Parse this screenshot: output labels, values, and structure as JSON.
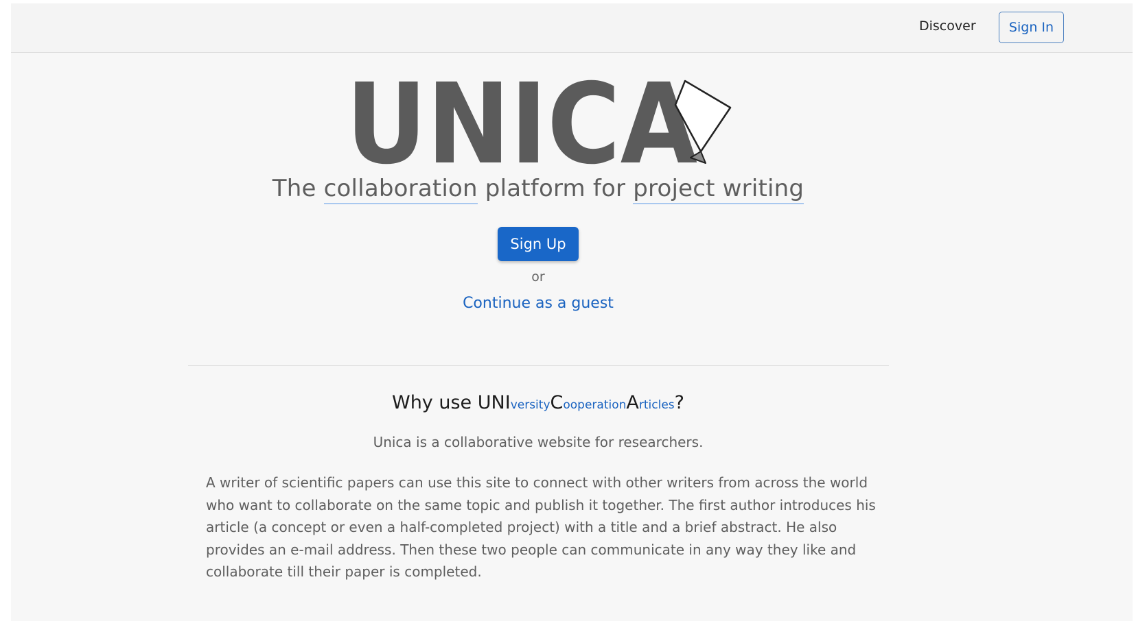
{
  "nav": {
    "discover": "Discover",
    "sign_in": "Sign In"
  },
  "hero": {
    "logo_text": "UNICA",
    "tagline": {
      "the": "The ",
      "collaboration": "collaboration",
      "middle": " platform for ",
      "project_writing": "project writing"
    },
    "sign_up": "Sign Up",
    "or": "or",
    "guest": "Continue as a guest"
  },
  "why": {
    "prefix": "Why use ",
    "uni": "UNI",
    "versity": "versity",
    "c": "C",
    "ooperation": "ooperation",
    "a": "A",
    "rticles": "rticles",
    "suffix": "?",
    "subtitle": "Unica is a collaborative website for researchers.",
    "paragraph": "A writer of scientific papers can use this site to connect with other writers from across the world who want to collaborate on the same topic and publish it together. The first author introduces his article (a concept or even a half-completed project) with a title and a brief abstract. He also provides an e-mail address. Then these two people can communicate in any way they like and collaborate till their paper is completed."
  },
  "colors": {
    "brand_blue": "#1967c8",
    "logo_gray": "#5b5b5b",
    "background": "#f7f7f7"
  }
}
